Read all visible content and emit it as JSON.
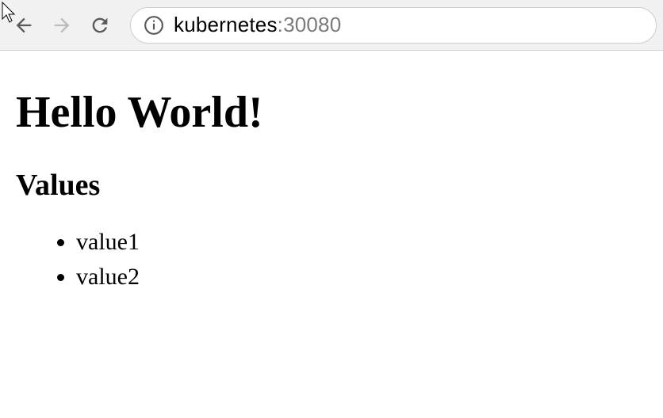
{
  "toolbar": {
    "url_host": "kubernetes",
    "url_port": ":30080"
  },
  "page": {
    "heading": "Hello World!",
    "subheading": "Values",
    "values": [
      "value1",
      "value2"
    ]
  }
}
